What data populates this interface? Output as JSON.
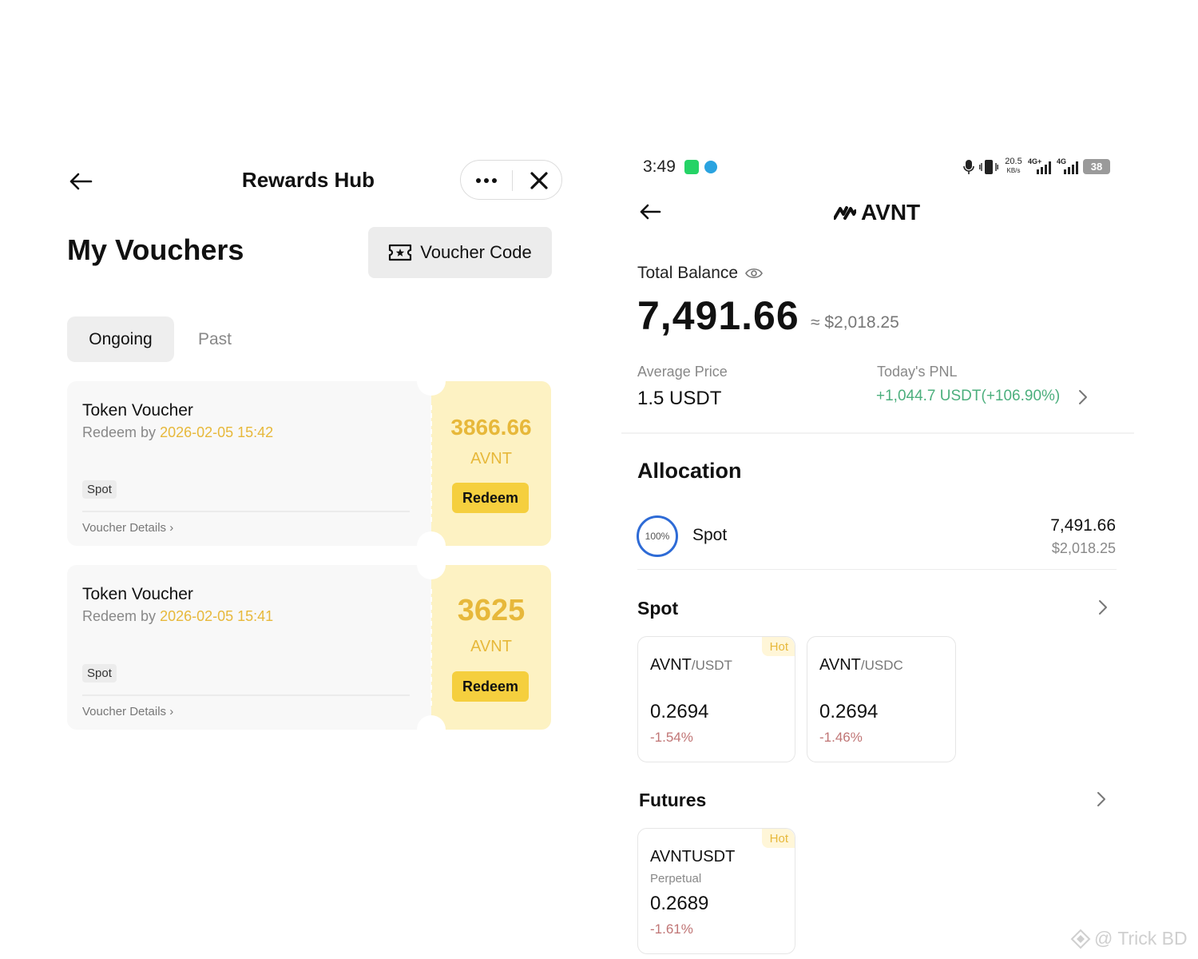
{
  "left": {
    "header": {
      "title": "Rewards Hub"
    },
    "page_title": "My Vouchers",
    "voucher_code_label": "Voucher Code",
    "tabs": [
      {
        "label": "Ongoing",
        "active": true
      },
      {
        "label": "Past",
        "active": false
      }
    ],
    "vouchers": [
      {
        "title": "Token Voucher",
        "redeem_prefix": "Redeem by ",
        "redeem_date": "2026-02-05 15:42",
        "tag": "Spot",
        "details_label": "Voucher Details ›",
        "amount": "3866.66",
        "unit": "AVNT",
        "button": "Redeem"
      },
      {
        "title": "Token Voucher",
        "redeem_prefix": "Redeem by ",
        "redeem_date": "2026-02-05 15:41",
        "tag": "Spot",
        "details_label": "Voucher Details ›",
        "amount": "3625",
        "unit": "AVNT",
        "button": "Redeem"
      }
    ]
  },
  "right": {
    "status_bar": {
      "time": "3:49",
      "speed_value": "20.5",
      "speed_unit": "KB/s",
      "network1": "4G+",
      "network2": "4G",
      "battery": "38"
    },
    "header": {
      "title": "AVNT"
    },
    "balance": {
      "label": "Total Balance",
      "value": "7,491.66",
      "usd": "≈ $2,018.25"
    },
    "average_price": {
      "label": "Average Price",
      "value": "1.5 USDT"
    },
    "pnl": {
      "label": "Today's PNL",
      "value": "+1,044.7 USDT(+106.90%)"
    },
    "allocation": {
      "title": "Allocation",
      "items": [
        {
          "percent": "100%",
          "name": "Spot",
          "value": "7,491.66",
          "usd": "$2,018.25"
        }
      ]
    },
    "spot": {
      "title": "Spot",
      "markets": [
        {
          "base": "AVNT",
          "quote": "/USDT",
          "price": "0.2694",
          "change": "-1.54%",
          "badge": "Hot"
        },
        {
          "base": "AVNT",
          "quote": "/USDC",
          "price": "0.2694",
          "change": "-1.46%",
          "badge": ""
        }
      ]
    },
    "futures": {
      "title": "Futures",
      "markets": [
        {
          "symbol": "AVNTUSDT",
          "type": "Perpetual",
          "price": "0.2689",
          "change": "-1.61%",
          "badge": "Hot"
        }
      ]
    }
  },
  "watermark": "@ Trick BD",
  "colors": {
    "accent_yellow": "#f5cf3e",
    "voucher_gold_text": "#e7b83a",
    "positive_green": "#4caf7d",
    "negative_red": "#c07575",
    "allocation_ring_blue": "#2e6bd6"
  }
}
